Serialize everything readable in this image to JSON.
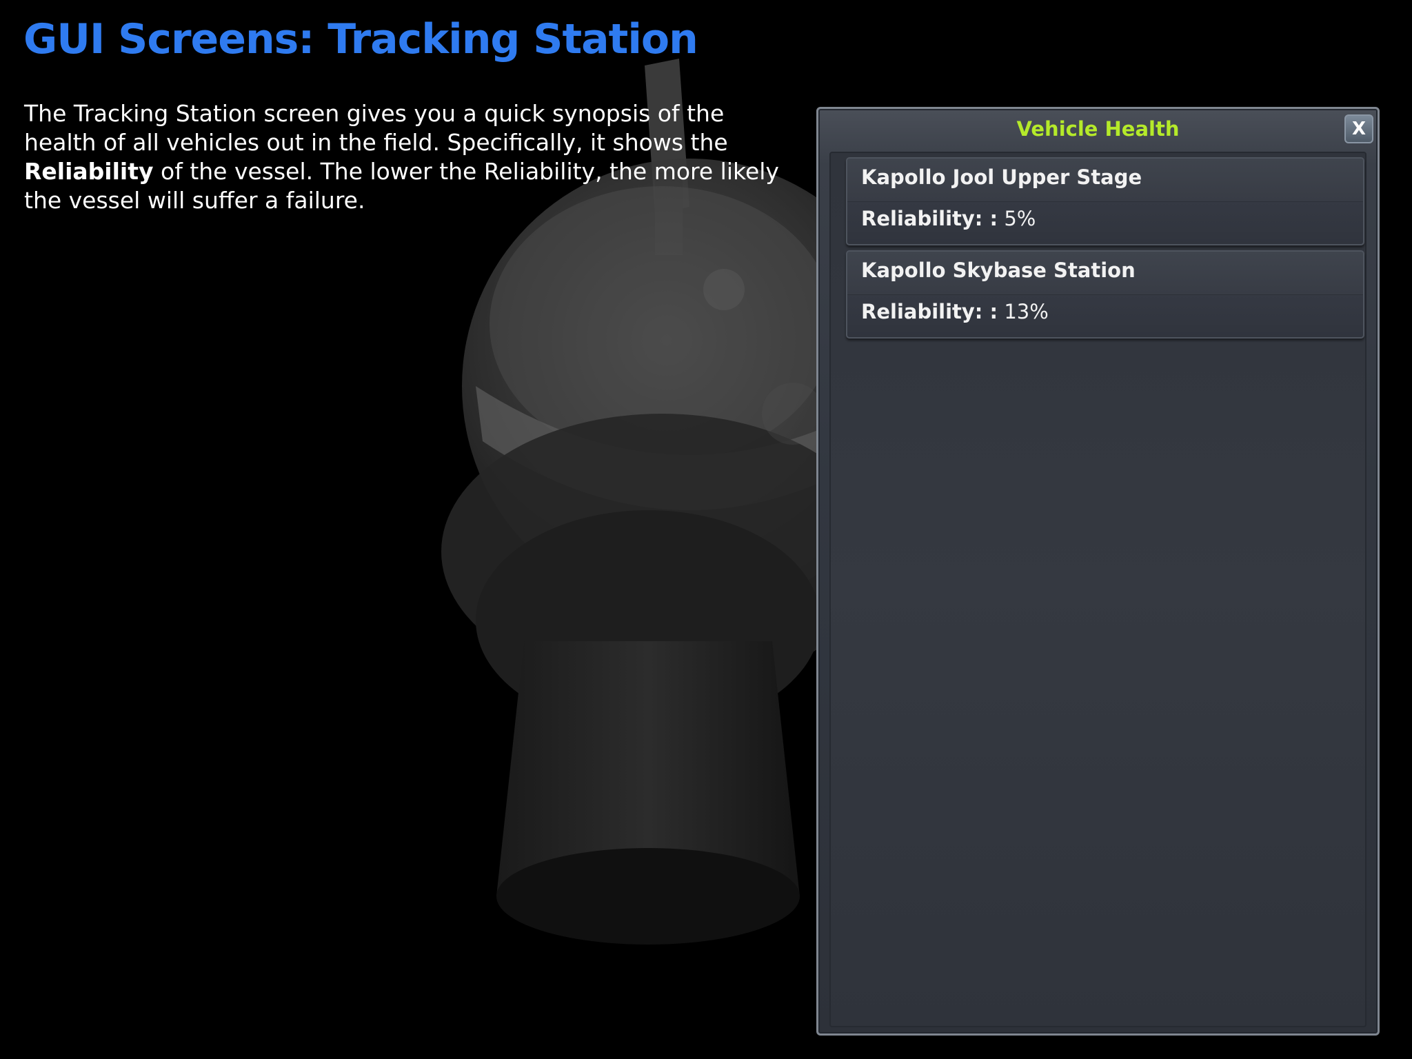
{
  "page": {
    "title": "GUI Screens: Tracking Station",
    "description": {
      "part1": "The Tracking Station screen gives you a quick synopsis of the health of all vehicles out in the field. Specifically, it shows the ",
      "bold": "Reliability",
      "part2": " of the vessel. The lower the Reliability, the more likely the vessel will suffer a failure."
    }
  },
  "vehicle_health": {
    "title": "Vehicle Health",
    "close_label": "X",
    "vehicles": [
      {
        "name": "Kapollo Jool Upper Stage",
        "reliability_label": "Reliability: :",
        "reliability_value": "5%"
      },
      {
        "name": "Kapollo Skybase Station",
        "reliability_label": "Reliability: :",
        "reliability_value": "13%"
      }
    ]
  },
  "colors": {
    "title": "#2f7bf0",
    "window_title": "#b5ea2a",
    "text": "#ffffff",
    "background": "#000000"
  },
  "icons": {
    "close": "close-icon"
  }
}
